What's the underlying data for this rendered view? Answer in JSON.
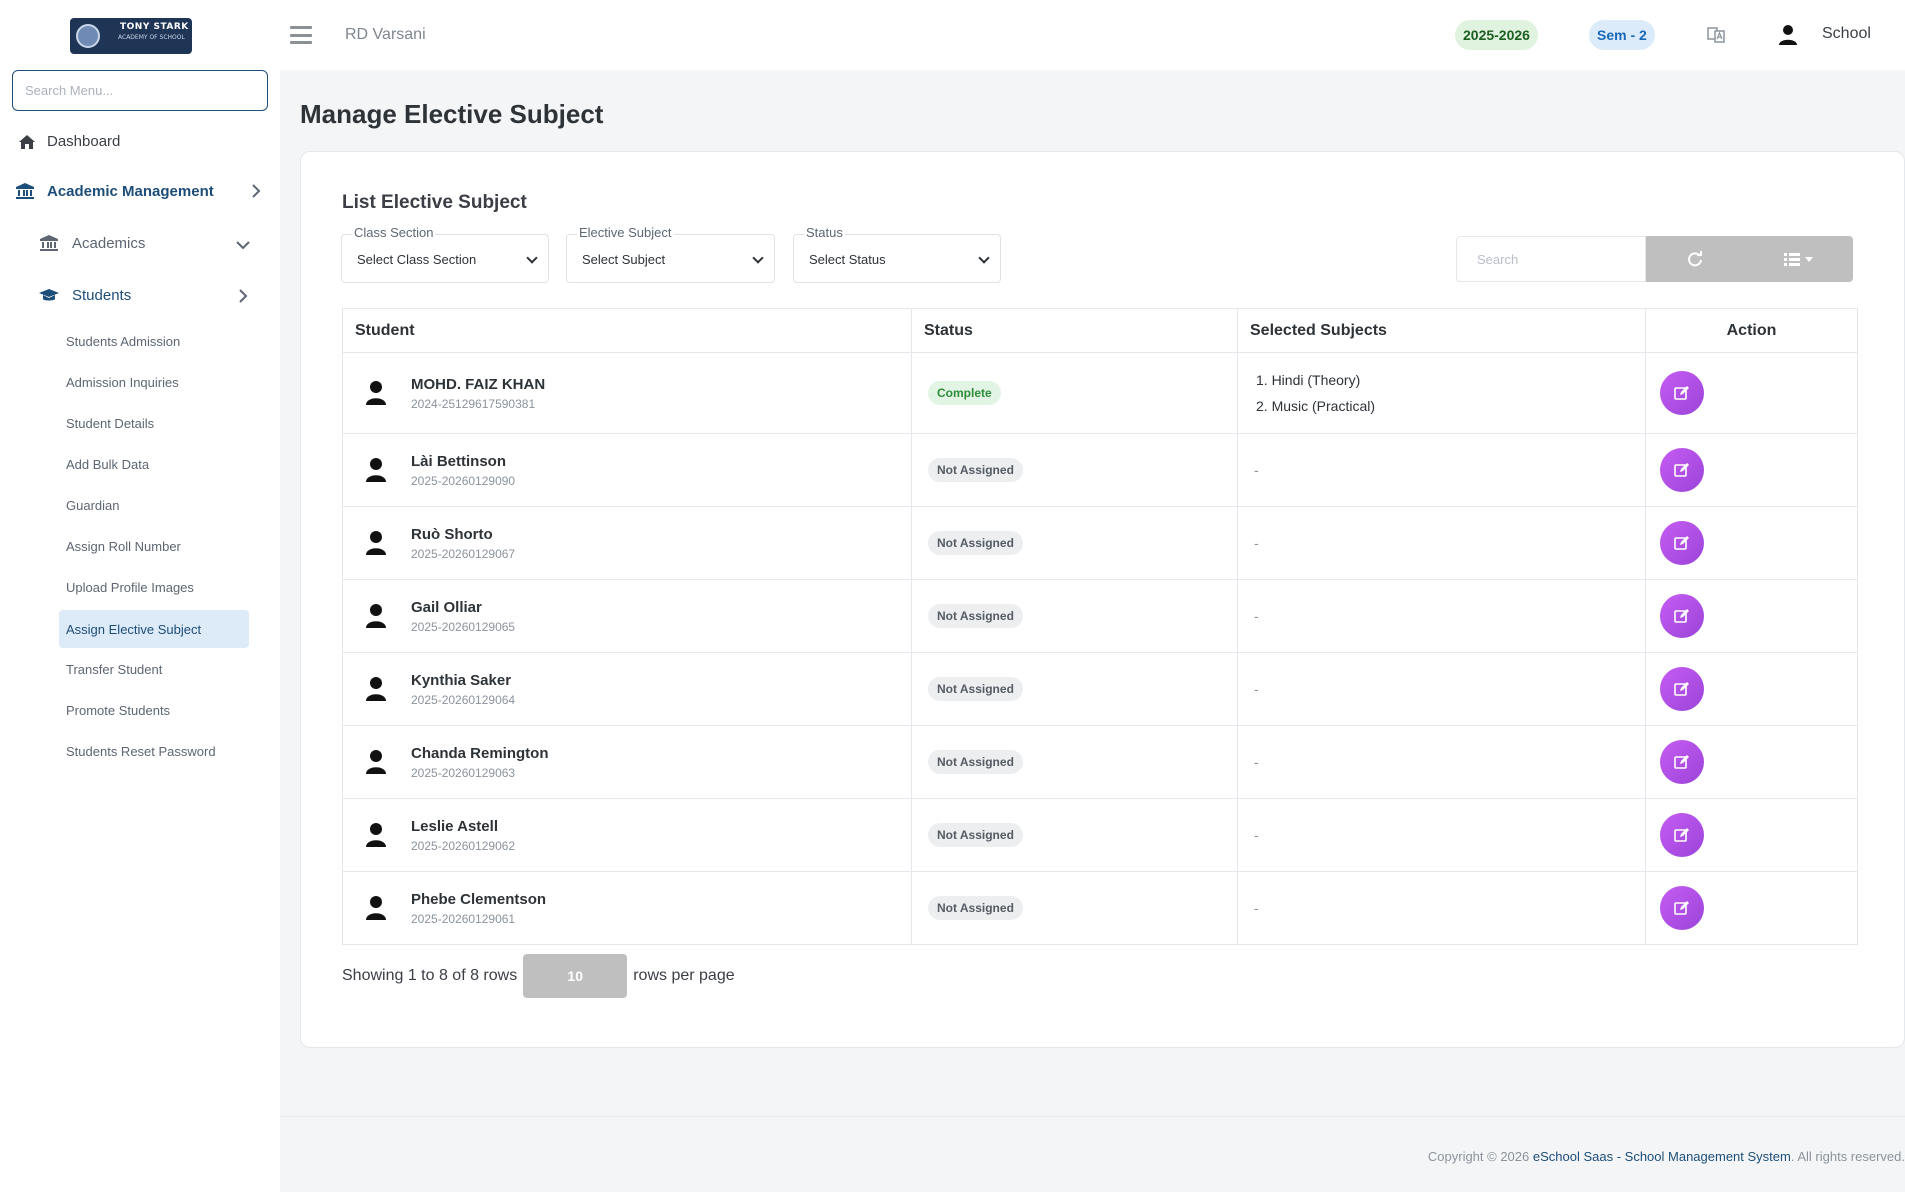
{
  "sidebar": {
    "logo_text": "TONY STARK",
    "logo_sub": "ACADEMY OF SCHOOL",
    "search_placeholder": "Search Menu...",
    "dashboard": "Dashboard",
    "academic_management": "Academic Management",
    "academics": "Academics",
    "students": "Students",
    "sub_items": [
      "Students Admission",
      "Admission Inquiries",
      "Student Details",
      "Add Bulk Data",
      "Guardian",
      "Assign Roll Number",
      "Upload Profile Images",
      "Assign Elective Subject",
      "Transfer Student",
      "Promote Students",
      "Students Reset Password"
    ]
  },
  "header": {
    "school_name": "RD Varsani",
    "year": "2025-2026",
    "semester": "Sem - 2",
    "user": "School"
  },
  "page": {
    "title": "Manage Elective Subject",
    "card_title": "List Elective Subject"
  },
  "filters": {
    "class_section_label": "Class Section",
    "class_section_value": "Select Class Section",
    "elective_label": "Elective Subject",
    "elective_value": "Select Subject",
    "status_label": "Status",
    "status_value": "Select Status",
    "search_placeholder": "Search"
  },
  "table": {
    "headers": [
      "Student",
      "Status",
      "Selected Subjects",
      "Action"
    ],
    "rows": [
      {
        "name": "MOHD. FAIZ KHAN",
        "id": "2024-25129617590381",
        "status": "Complete",
        "subjects": [
          "1. Hindi (Theory)",
          "2. Music (Practical)"
        ]
      },
      {
        "name": "Lài Bettinson",
        "id": "2025-20260129090",
        "status": "Not Assigned",
        "subjects": "-"
      },
      {
        "name": "Ruò Shorto",
        "id": "2025-20260129067",
        "status": "Not Assigned",
        "subjects": "-"
      },
      {
        "name": "Gail Olliar",
        "id": "2025-20260129065",
        "status": "Not Assigned",
        "subjects": "-"
      },
      {
        "name": "Kynthia Saker",
        "id": "2025-20260129064",
        "status": "Not Assigned",
        "subjects": "-"
      },
      {
        "name": "Chanda Remington",
        "id": "2025-20260129063",
        "status": "Not Assigned",
        "subjects": "-"
      },
      {
        "name": "Leslie Astell",
        "id": "2025-20260129062",
        "status": "Not Assigned",
        "subjects": "-"
      },
      {
        "name": "Phebe Clementson",
        "id": "2025-20260129061",
        "status": "Not Assigned",
        "subjects": "-"
      }
    ]
  },
  "pagination": {
    "showing": "Showing 1 to 8 of 8 rows",
    "per_page": "10",
    "suffix": "rows per page"
  },
  "footer": {
    "prefix": "Copyright © 2026",
    "link": "eSchool Saas - School Management System",
    "suffix": ". All rights reserved."
  },
  "colors": {
    "primary": "#1d4e7a",
    "accent": "#b350e6",
    "complete": "#2e8b3a",
    "year_badge": "#dff3df",
    "sem_badge": "#dcebfa"
  }
}
